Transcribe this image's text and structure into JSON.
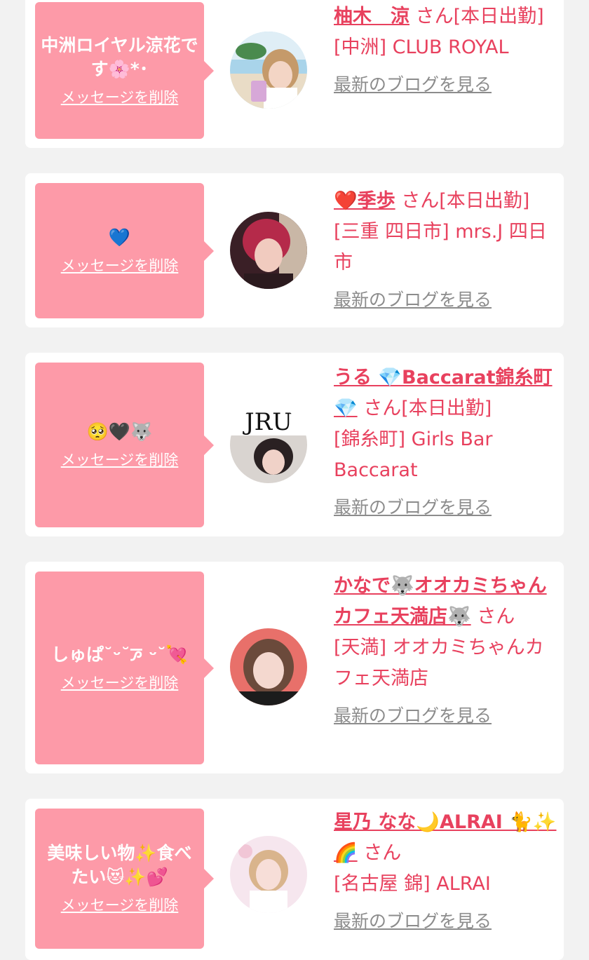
{
  "cards": [
    {
      "message": "中洲ロイヤル涼花です🌸*･",
      "delete_label": "メッセージを削除",
      "name": "柚木　涼",
      "honorific": "さん[本日出勤]",
      "shop": "[中洲] CLUB ROYAL",
      "blog_label": "最新のブログを見る"
    },
    {
      "message": "💙",
      "delete_label": "メッセージを削除",
      "name": "❤️季歩",
      "honorific": "さん[本日出勤]",
      "shop": "[三重 四日市] mrs.J 四日市",
      "blog_label": "最新のブログを見る"
    },
    {
      "message": "🥺🖤🐺",
      "delete_label": "メッセージを削除",
      "name": "うる 💎Baccarat錦糸町💎",
      "honorific": "さん[本日出勤]",
      "shop": "[錦糸町] Girls Bar Baccarat",
      "blog_label": "最新のブログを見る",
      "avatar_text": "JRU"
    },
    {
      "message": "しゅぱ˘ᵕ˘ꯍ ᵕ˘💘",
      "delete_label": "メッセージを削除",
      "name": "かなで🐺オオカミちゃんカフェ天満店🐺",
      "honorific": "さん",
      "shop": "[天満] オオカミちゃんカフェ天満店",
      "blog_label": "最新のブログを見る"
    },
    {
      "message": "美味しい物✨食べたい😻✨💕",
      "delete_label": "メッセージを削除",
      "name": "星乃 なな🌙ALRAI 🐈✨🌈",
      "honorific": "さん",
      "shop": "[名古屋 錦] ALRAI",
      "blog_label": "最新のブログを見る"
    }
  ],
  "colors": {
    "bubble": "#fd9aa8",
    "accent": "#e8415e",
    "muted": "#8c8c8c",
    "background": "#f2f2f2"
  }
}
